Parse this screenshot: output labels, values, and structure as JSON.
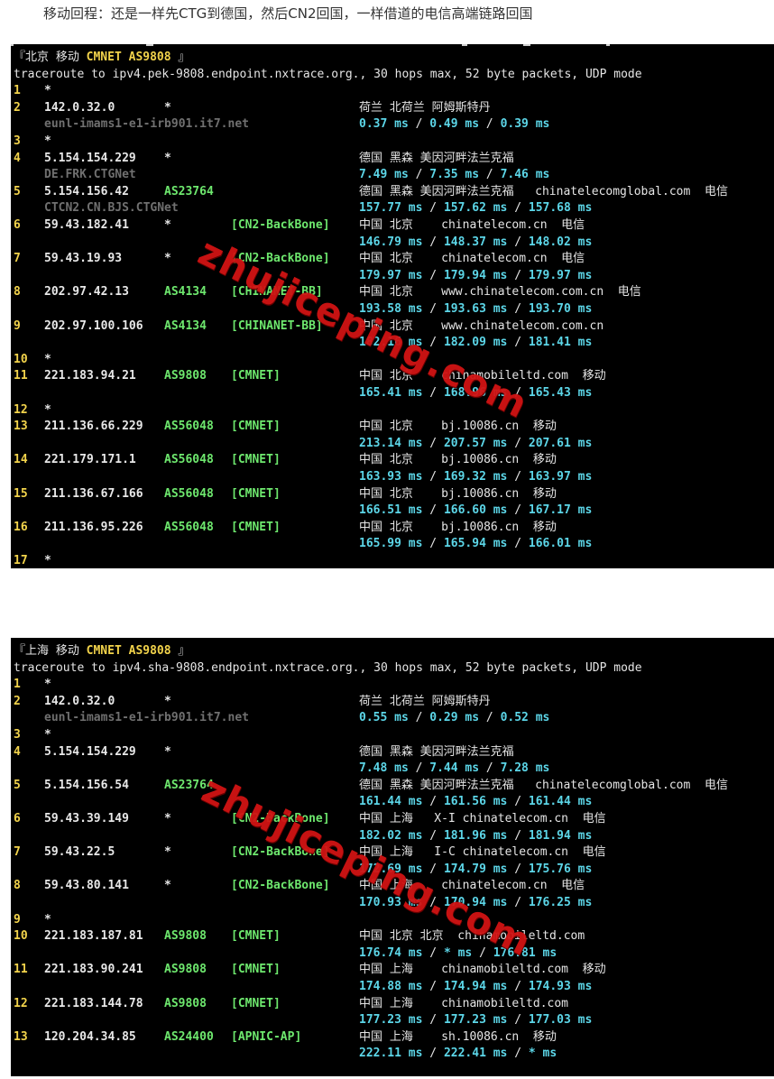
{
  "caption": "移动回程：还是一样先CTG到德国，然后CN2回国，一样借道的电信高端链路回国",
  "watermark": "zhujiceping.com",
  "traces": [
    {
      "header_prefix": "『北京 移动 ",
      "header_bold": "CMNET AS9808",
      "header_suffix": " 』",
      "command": "traceroute to ipv4.pek-9808.endpoint.nxtrace.org., 30 hops max, 52 byte packets, UDP mode",
      "hops": [
        {
          "n": "1",
          "star": "*"
        },
        {
          "n": "2",
          "ip": "142.0.32.0",
          "asn": "*",
          "geo": "荷兰 北荷兰 阿姆斯特丹",
          "host": "eunl-imams1-e1-irb901.it7.net",
          "rtt": [
            "0.37 ms",
            "0.49 ms",
            "0.39 ms"
          ]
        },
        {
          "n": "3",
          "star": "*"
        },
        {
          "n": "4",
          "ip": "5.154.154.229",
          "asn": "*",
          "geo": "德国 黑森 美因河畔法兰克福",
          "host": "DE.FRK.CTGNet",
          "rtt": [
            "7.49 ms",
            "7.35 ms",
            "7.46 ms"
          ]
        },
        {
          "n": "5",
          "ip": "5.154.156.42",
          "asn": "AS23764",
          "geo": "德国 黑森 美因河畔法兰克福   chinatelecomglobal.com  电信",
          "host": "CTCN2.CN.BJS.CTGNet",
          "rtt": [
            "157.77 ms",
            "157.62 ms",
            "157.68 ms"
          ]
        },
        {
          "n": "6",
          "ip": "59.43.182.41",
          "asn": "*",
          "tag": "[CN2-BackBone]",
          "geo": "中国 北京    chinatelecom.cn  电信",
          "rtt": [
            "146.79 ms",
            "148.37 ms",
            "148.02 ms"
          ]
        },
        {
          "n": "7",
          "ip": "59.43.19.93",
          "asn": "*",
          "tag": "[CN2-BackBone]",
          "geo": "中国 北京    chinatelecom.cn  电信",
          "rtt": [
            "179.97 ms",
            "179.94 ms",
            "179.97 ms"
          ]
        },
        {
          "n": "8",
          "ip": "202.97.42.13",
          "asn": "AS4134",
          "tag": "[CHINANET-BB]",
          "geo": "中国 北京    www.chinatelecom.com.cn  电信",
          "rtt": [
            "193.58 ms",
            "193.63 ms",
            "193.70 ms"
          ]
        },
        {
          "n": "9",
          "ip": "202.97.100.106",
          "asn": "AS4134",
          "tag": "[CHINANET-BB]",
          "geo": "中国 北京    www.chinatelecom.com.cn",
          "rtt": [
            "182.16 ms",
            "182.09 ms",
            "181.41 ms"
          ]
        },
        {
          "n": "10",
          "star": "*"
        },
        {
          "n": "11",
          "ip": "221.183.94.21",
          "asn": "AS9808",
          "tag": "[CMNET]",
          "geo": "中国 北京    chinamobileltd.com  移动",
          "rtt": [
            "165.41 ms",
            "168.96 ms",
            "165.43 ms"
          ]
        },
        {
          "n": "12",
          "star": "*"
        },
        {
          "n": "13",
          "ip": "211.136.66.229",
          "asn": "AS56048",
          "tag": "[CMNET]",
          "geo": "中国 北京    bj.10086.cn  移动",
          "rtt": [
            "213.14 ms",
            "207.57 ms",
            "207.61 ms"
          ]
        },
        {
          "n": "14",
          "ip": "221.179.171.1",
          "asn": "AS56048",
          "tag": "[CMNET]",
          "geo": "中国 北京    bj.10086.cn  移动",
          "rtt": [
            "163.93 ms",
            "169.32 ms",
            "163.97 ms"
          ]
        },
        {
          "n": "15",
          "ip": "211.136.67.166",
          "asn": "AS56048",
          "tag": "[CMNET]",
          "geo": "中国 北京    bj.10086.cn  移动",
          "rtt": [
            "166.51 ms",
            "166.60 ms",
            "167.17 ms"
          ]
        },
        {
          "n": "16",
          "ip": "211.136.95.226",
          "asn": "AS56048",
          "tag": "[CMNET]",
          "geo": "中国 北京    bj.10086.cn  移动",
          "rtt": [
            "165.99 ms",
            "165.94 ms",
            "166.01 ms"
          ]
        },
        {
          "n": "17",
          "star": "*"
        }
      ]
    },
    {
      "header_prefix": "『上海 移动 ",
      "header_bold": "CMNET AS9808",
      "header_suffix": " 』",
      "command": "traceroute to ipv4.sha-9808.endpoint.nxtrace.org., 30 hops max, 52 byte packets, UDP mode",
      "hops": [
        {
          "n": "1",
          "star": "*"
        },
        {
          "n": "2",
          "ip": "142.0.32.0",
          "asn": "*",
          "geo": "荷兰 北荷兰 阿姆斯特丹",
          "host": "eunl-imams1-e1-irb901.it7.net",
          "rtt": [
            "0.55 ms",
            "0.29 ms",
            "0.52 ms"
          ]
        },
        {
          "n": "3",
          "star": "*"
        },
        {
          "n": "4",
          "ip": "5.154.154.229",
          "asn": "*",
          "geo": "德国 黑森 美因河畔法兰克福",
          "rtt": [
            "7.48 ms",
            "7.44 ms",
            "7.28 ms"
          ]
        },
        {
          "n": "5",
          "ip": "5.154.156.54",
          "asn": "AS23764",
          "geo": "德国 黑森 美因河畔法兰克福   chinatelecomglobal.com  电信",
          "rtt": [
            "161.44 ms",
            "161.56 ms",
            "161.44 ms"
          ]
        },
        {
          "n": "6",
          "ip": "59.43.39.149",
          "asn": "*",
          "tag": "[CN2-BackBone]",
          "geo": "中国 上海   X-I chinatelecom.cn  电信",
          "rtt": [
            "182.02 ms",
            "181.96 ms",
            "181.94 ms"
          ]
        },
        {
          "n": "7",
          "ip": "59.43.22.5",
          "asn": "*",
          "tag": "[CN2-BackBone]",
          "geo": "中国 上海   I-C chinatelecom.cn  电信",
          "rtt": [
            "172.69 ms",
            "174.79 ms",
            "175.76 ms"
          ]
        },
        {
          "n": "8",
          "ip": "59.43.80.141",
          "asn": "*",
          "tag": "[CN2-BackBone]",
          "geo": "中国 上海    chinatelecom.cn  电信",
          "rtt": [
            "170.93 ms",
            "170.94 ms",
            "176.25 ms"
          ]
        },
        {
          "n": "9",
          "star": "*"
        },
        {
          "n": "10",
          "ip": "221.183.187.81",
          "asn": "AS9808",
          "tag": "[CMNET]",
          "geo": "中国 北京 北京  chinamobileltd.com",
          "rtt": [
            "176.74 ms",
            "* ms",
            "176.81 ms"
          ]
        },
        {
          "n": "11",
          "ip": "221.183.90.241",
          "asn": "AS9808",
          "tag": "[CMNET]",
          "geo": "中国 上海    chinamobileltd.com  移动",
          "rtt": [
            "174.88 ms",
            "174.94 ms",
            "174.93 ms"
          ]
        },
        {
          "n": "12",
          "ip": "221.183.144.78",
          "asn": "AS9808",
          "tag": "[CMNET]",
          "geo": "中国 上海    chinamobileltd.com",
          "rtt": [
            "177.23 ms",
            "177.23 ms",
            "177.03 ms"
          ]
        },
        {
          "n": "13",
          "ip": "120.204.34.85",
          "asn": "AS24400",
          "tag": "[APNIC-AP]",
          "geo": "中国 上海    sh.10086.cn  移动",
          "rtt": [
            "222.11 ms",
            "222.41 ms",
            "* ms"
          ]
        }
      ]
    }
  ]
}
